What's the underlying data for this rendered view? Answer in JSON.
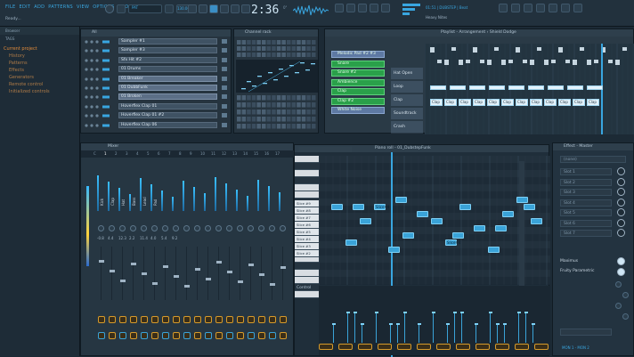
{
  "menu": [
    "FILE",
    "EDIT",
    "ADD",
    "PATTERNS",
    "VIEW",
    "OPTIONS",
    "TOOLS",
    "HELP"
  ],
  "hint": "Ready...",
  "transport": {
    "time": "2:36",
    "time_sub": "0\"",
    "pat_label": "PAT",
    "song_label": "SONG",
    "bpm": "130.000",
    "tempo_icon": "metronome-icon",
    "info_line": "01:51 | DUBSTEP | Beat",
    "project_name": "Heavy Nites"
  },
  "browser": {
    "title": "Browser",
    "tabs_label": "TAGS",
    "items": [
      {
        "label": "Current project",
        "level": 0
      },
      {
        "label": "History",
        "level": 1
      },
      {
        "label": "Patterns",
        "level": 1
      },
      {
        "label": "Effects",
        "level": 1
      },
      {
        "label": "Generators",
        "level": 1
      },
      {
        "label": "Remote control",
        "level": 1
      },
      {
        "label": "Initialized controls",
        "level": 1
      }
    ]
  },
  "channel_rack": {
    "title": "Channel rack",
    "filter": "All",
    "channels": [
      {
        "name": "Sampler #1",
        "selected": false
      },
      {
        "name": "Sampler #3",
        "selected": false
      },
      {
        "name": "Sfx Hit #2",
        "selected": false
      },
      {
        "name": "01 Drums",
        "selected": false
      },
      {
        "name": "01 Breaker",
        "selected": true
      },
      {
        "name": "01 DubbFunk",
        "selected": true
      },
      {
        "name": "01 Broken",
        "selected": true
      },
      {
        "name": "Hoverflex Clap 01",
        "selected": false
      },
      {
        "name": "Hoverflex Clap 01 #2",
        "selected": false
      },
      {
        "name": "Hoverflex Clap 06",
        "selected": false
      }
    ]
  },
  "playlist": {
    "title": "Playlist - Arrangement",
    "breadcrumb": "Shield Dodge",
    "patterns": [
      {
        "label": "Melodic Pad #2 #3",
        "style": "top"
      },
      {
        "label": "Snare",
        "style": "green"
      },
      {
        "label": "Snare #2",
        "style": "green"
      },
      {
        "label": "Ambience",
        "style": "green"
      },
      {
        "label": "Clap",
        "style": "green"
      },
      {
        "label": "Clap #2",
        "style": "green"
      },
      {
        "label": "White Noise",
        "style": "top"
      }
    ],
    "tracks": [
      "Hat Open",
      "Loop",
      "Clap",
      "Soundtrack",
      "Crash"
    ],
    "clip_label": "Clap"
  },
  "mixer": {
    "title": "Mixer",
    "insert_labels": [
      "Kick",
      "Clap",
      "Hat",
      "Bass",
      "Lead",
      "Pad"
    ],
    "values": [
      "-0.8",
      "4.4",
      "12.3",
      "2.2",
      "11.4",
      "4.0",
      "5.4",
      "9.2"
    ]
  },
  "piano_roll": {
    "title": "Piano roll - 01_DubstepFunk",
    "keys": [
      "Slice #9",
      "Slice #8",
      "Slice #7",
      "Slice #6",
      "Slice #5",
      "Slice #4",
      "Slice #3",
      "Slice #2"
    ],
    "note_label": "Slice#8",
    "note_label_b": "Slice#4",
    "control_label": "Control"
  },
  "channel_settings": {
    "title": "Effect - Master",
    "preset": "(none)",
    "slots": [
      "Slot 1",
      "Slot 2",
      "Slot 3",
      "Slot 4",
      "Slot 5",
      "Slot 6",
      "Slot 7"
    ],
    "master": "Maximus",
    "fx": "Fruity Parametric",
    "out_label": "MON 1 - MON 2"
  },
  "colors": {
    "accent": "#39a6e0",
    "note": "#3aa3d8",
    "pattern_green": "#2aa04a",
    "orange": "#d69a2a"
  }
}
